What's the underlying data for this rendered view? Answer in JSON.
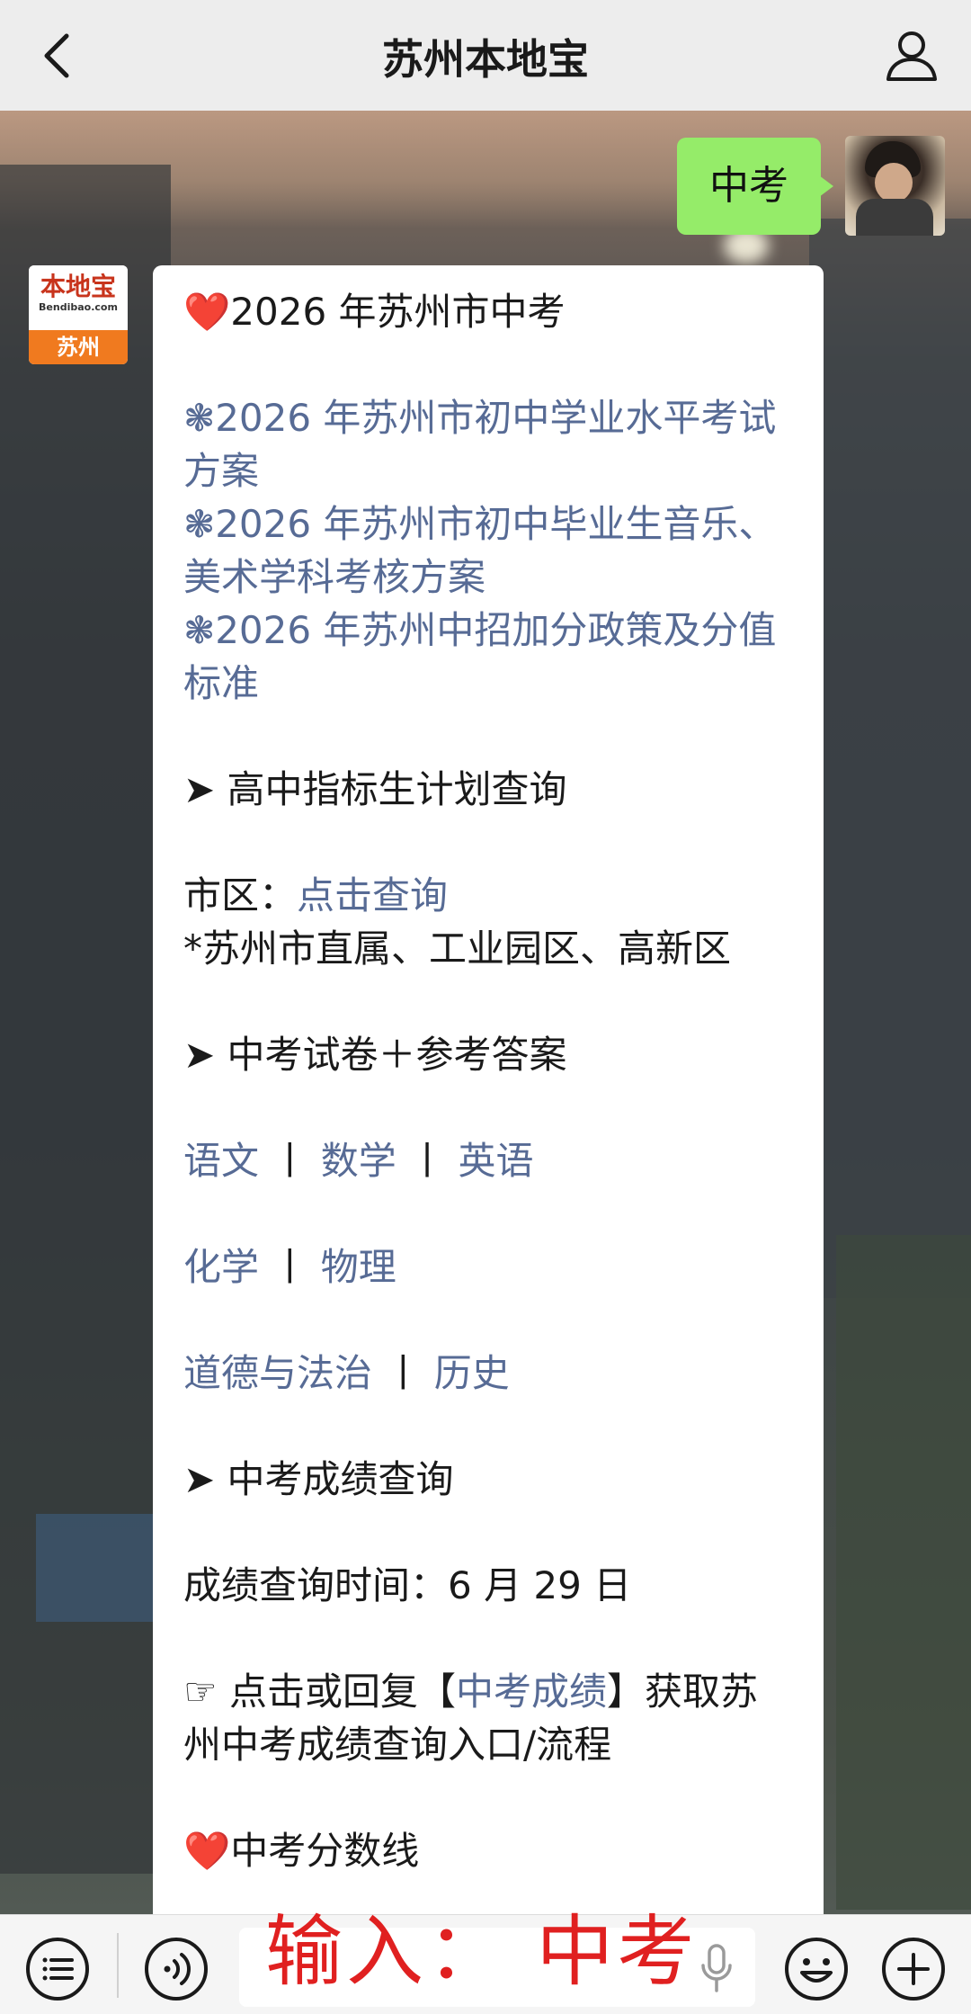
{
  "navbar": {
    "title": "苏州本地宝",
    "back_icon": "chevron-left-icon",
    "profile_icon": "person-icon"
  },
  "messages": {
    "user": {
      "text": "中考"
    },
    "bot": {
      "avatar": {
        "logo_cn": "本地宝",
        "logo_en": "Bendibao.com",
        "city": "苏州"
      },
      "heading1": "❤️2026 年苏州市中考",
      "links1": [
        "❃2026 年苏州市初中学业水平考试方案",
        "❃2026 年苏州市初中毕业生音乐、美术学科考核方案",
        "❃2026 年苏州中招加分政策及分值标准"
      ],
      "section1": "➤ 高中指标生计划查询",
      "city_label": "市区：",
      "city_link": "点击查询",
      "city_note": "*苏州市直属、工业园区、高新区",
      "section2": "➤ 中考试卷＋参考答案",
      "subjects_row1": {
        "a": "语文",
        "b": "数学",
        "c": "英语"
      },
      "subjects_row2": {
        "a": "化学",
        "b": "物理"
      },
      "subjects_row3": {
        "a": "道德与法治",
        "b": "历史"
      },
      "separator": "丨",
      "section3": "➤ 中考成绩查询",
      "score_time": "成绩查询时间：6 月 29 日",
      "reply_prefix": "☞ 点击或回复【",
      "reply_link": "中考成绩",
      "reply_suffix": "】获取苏州中考成绩查询入口/流程",
      "heading2": "❤️中考分数线"
    }
  },
  "inputbar": {
    "overlay_text": "输入：  中考",
    "icons": [
      "menu-list-icon",
      "voice-icon",
      "microphone-icon",
      "emoji-icon",
      "plus-icon"
    ]
  },
  "colors": {
    "link": "#576b95",
    "user_bubble": "#95ec69",
    "overlay_red": "#e02020",
    "navbar_bg": "#ededed"
  }
}
